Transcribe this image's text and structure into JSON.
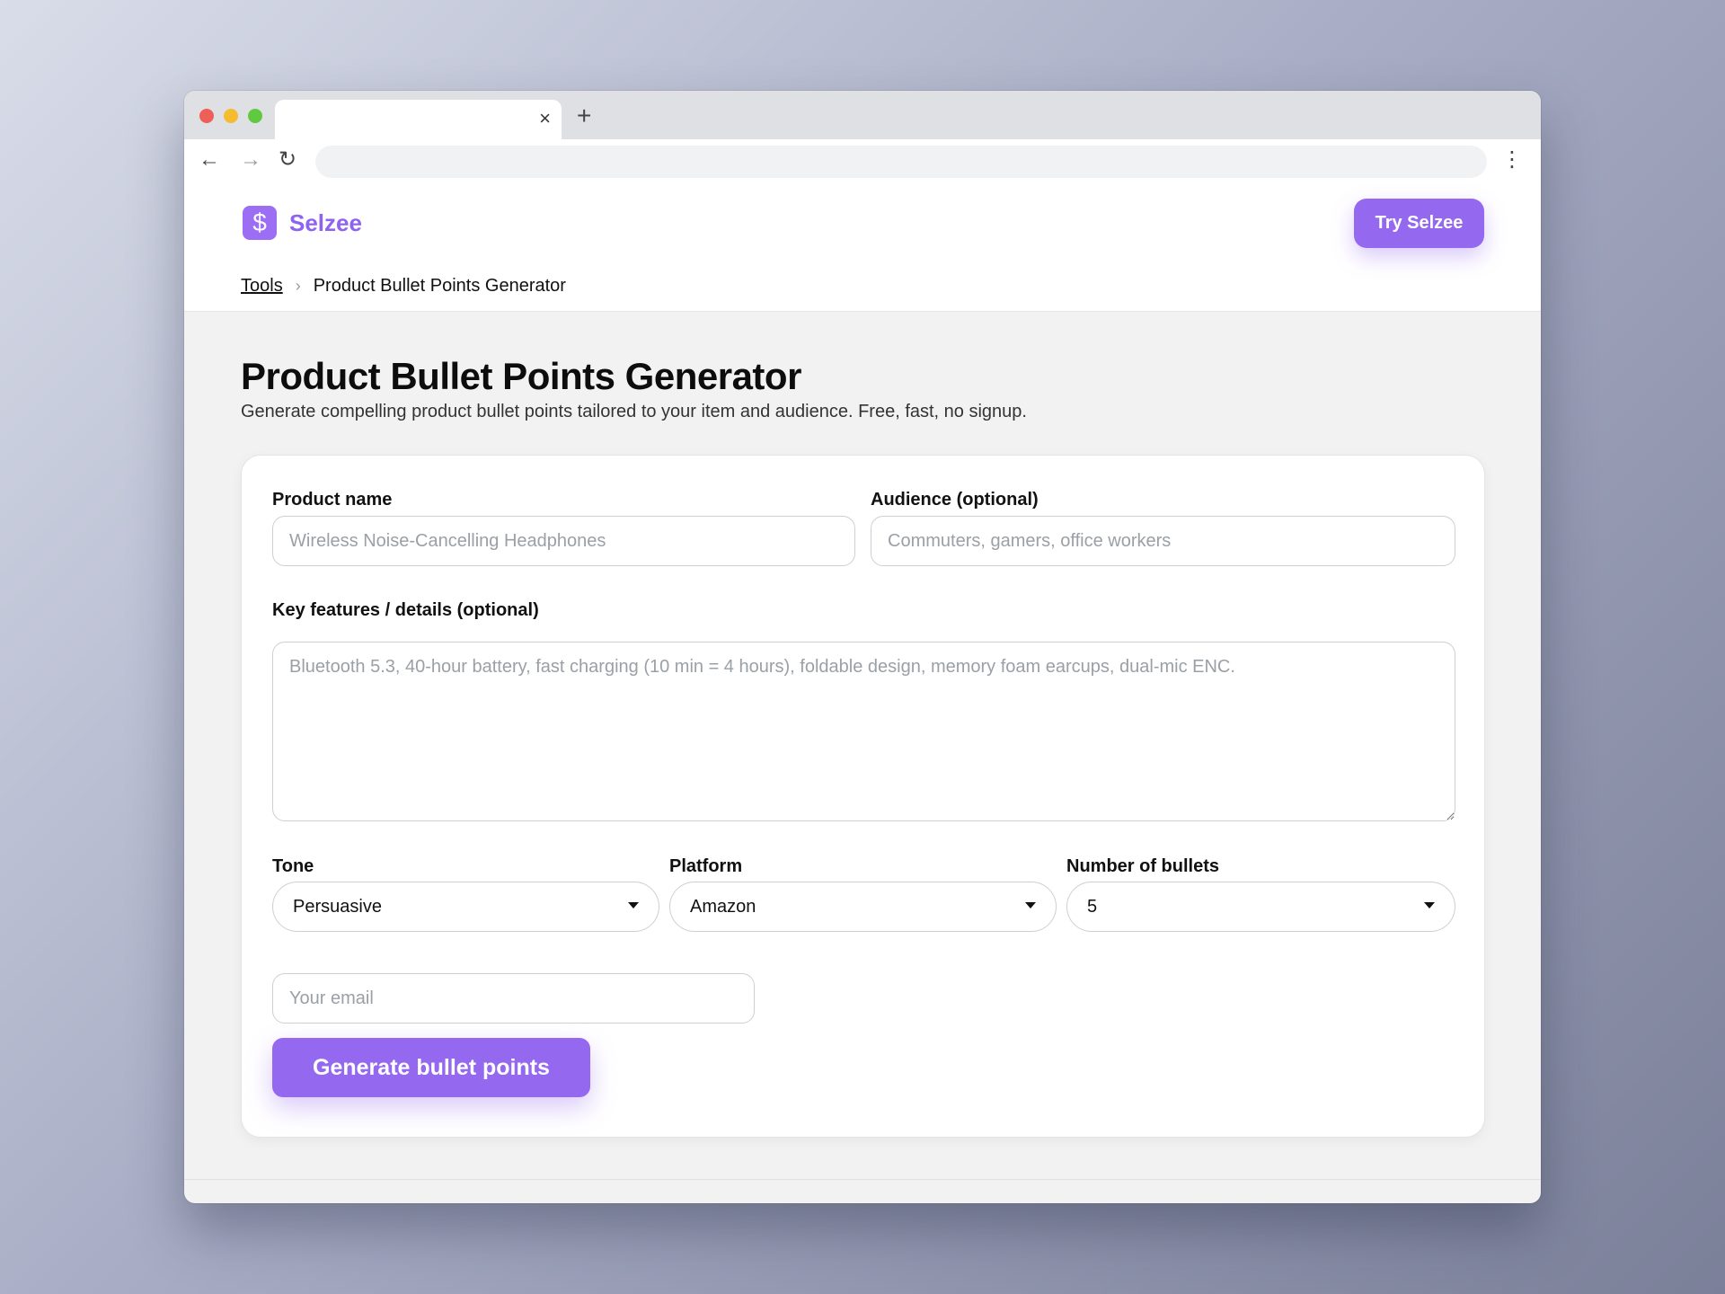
{
  "browser": {
    "tab_title": "",
    "tab_close": "×",
    "new_tab": "+",
    "url": "",
    "back": "←",
    "forward": "→",
    "reload": "↻",
    "menu": "⋮"
  },
  "header": {
    "logo_glyph": "$",
    "brand": "Selzee",
    "cta": "Try Selzee",
    "accent_color": "#9568f0"
  },
  "breadcrumb": {
    "parent": "Tools",
    "separator": "›",
    "current": "Product Bullet Points Generator"
  },
  "page": {
    "title": "Product Bullet Points Generator",
    "subtitle": "Generate compelling product bullet points tailored to your item and audience. Free, fast, no signup."
  },
  "form": {
    "product_name": {
      "label": "Product name",
      "placeholder": "Wireless Noise-Cancelling Headphones",
      "value": ""
    },
    "audience": {
      "label": "Audience (optional)",
      "placeholder": "Commuters, gamers, office workers",
      "value": ""
    },
    "features": {
      "label": "Key features / details (optional)",
      "placeholder": "Bluetooth 5.3, 40-hour battery, fast charging (10 min = 4 hours), foldable design, memory foam earcups, dual-mic ENC.",
      "value": ""
    },
    "tone": {
      "label": "Tone",
      "selected": "Persuasive"
    },
    "platform": {
      "label": "Platform",
      "selected": "Amazon"
    },
    "bullets": {
      "label": "Number of bullets",
      "selected": "5"
    },
    "email": {
      "placeholder": "Your email",
      "value": ""
    },
    "submit": "Generate bullet points"
  }
}
